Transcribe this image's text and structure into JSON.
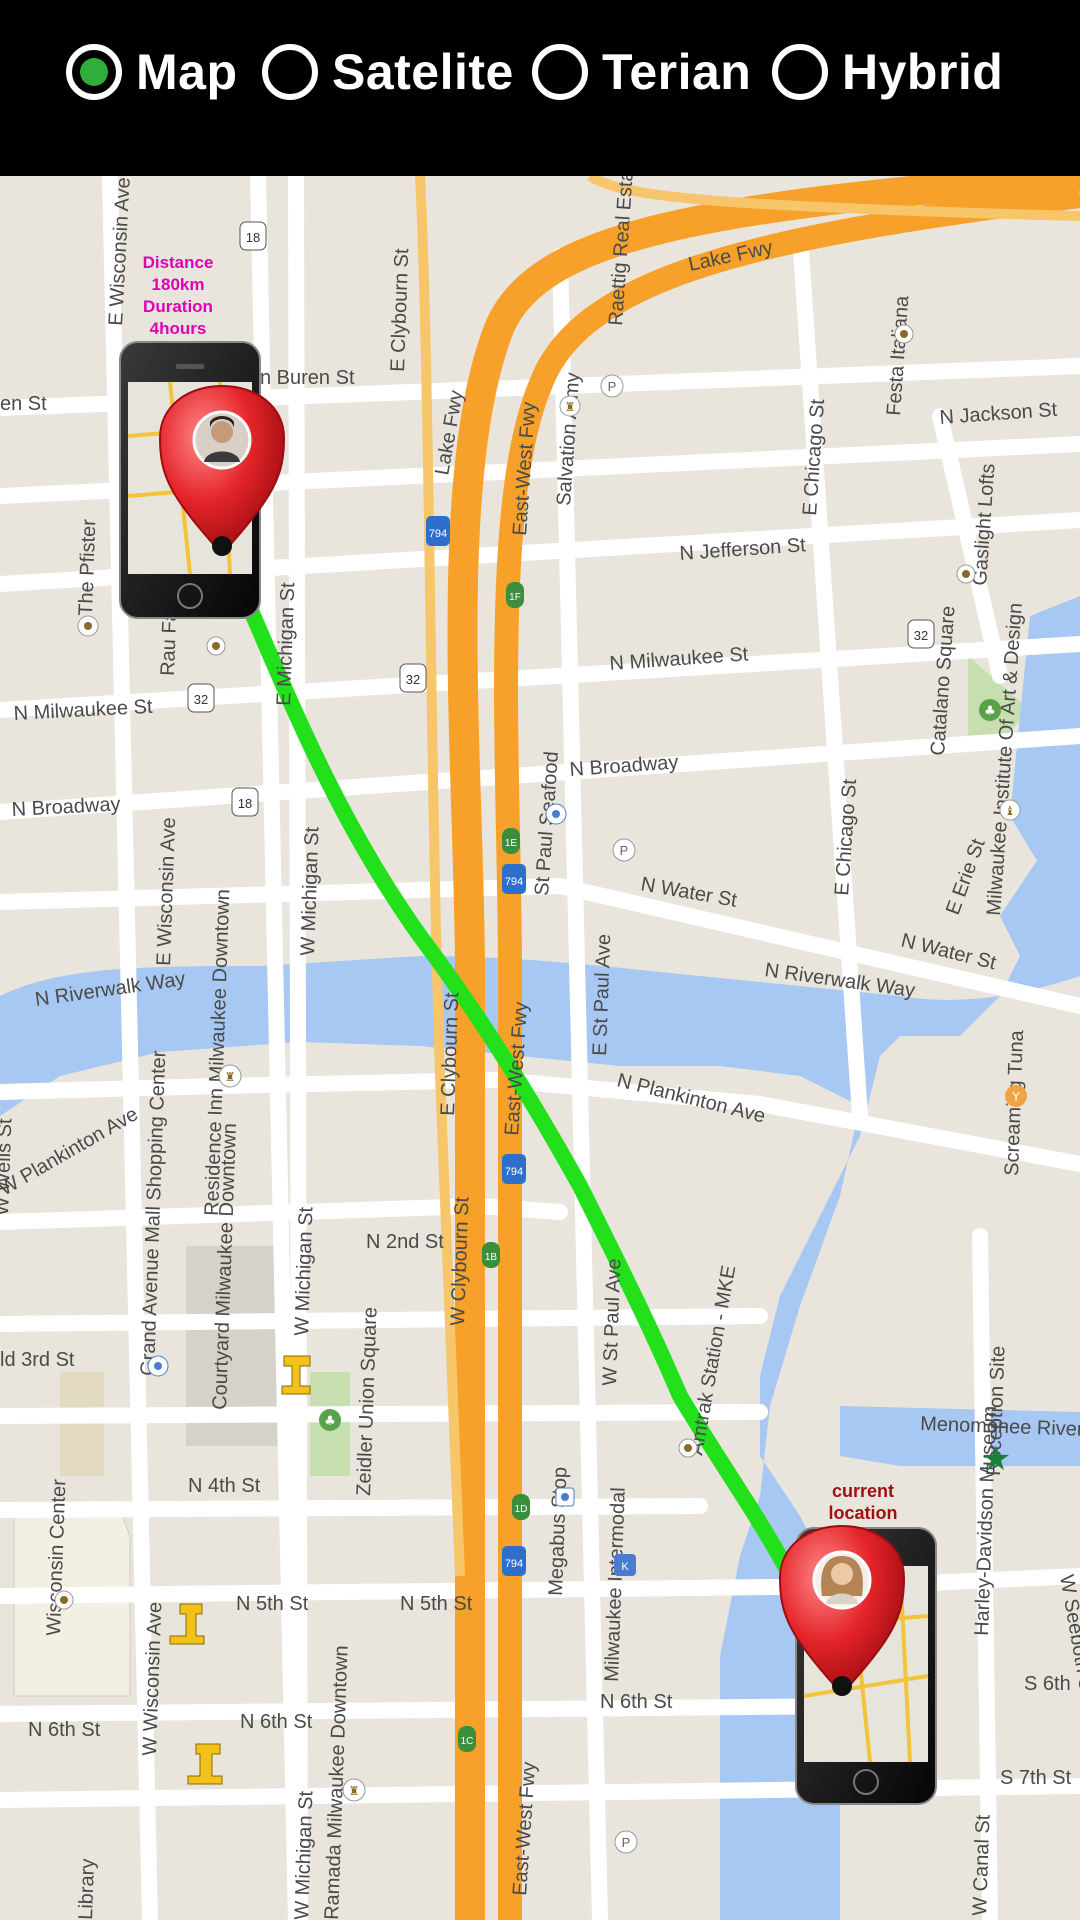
{
  "map_type_options": [
    {
      "label": "Map",
      "selected": true
    },
    {
      "label": "Satelite",
      "selected": false
    },
    {
      "label": "Terian",
      "selected": false
    },
    {
      "label": "Hybrid",
      "selected": false
    }
  ],
  "route": {
    "distance_label": "Distance",
    "distance_value": "180km",
    "duration_label": "Duration",
    "duration_value": "4hours",
    "current_location_line1": "current",
    "current_location_line2": "location",
    "route_color": "#22e01a"
  },
  "streets": {
    "lake_fwy": "Lake Fwy",
    "lake_fwy_top": "Lake Fwy",
    "east_west_fwy": "East-West Fwy",
    "n_jackson": "N Jackson St",
    "n_jefferson": "N Jefferson St",
    "n_milwaukee": "N Milwaukee St",
    "n_milwaukee_w": "N Milwaukee St",
    "n_broadway": "N Broadway",
    "n_broadway_w": "N Broadway",
    "n_water": "N Water St",
    "n_water_e": "N Water St",
    "riverwalk": "N Riverwalk Way",
    "riverwalk_e": "N Riverwalk Way",
    "plankinton": "W Plankinton Ave",
    "plankinton_e": "N Plankinton Ave",
    "n_2nd": "N 2nd St",
    "n_3rd": "ld 3rd St",
    "n_4th": "N 4th St",
    "n_5th": "N 5th St",
    "n_5th_w": "N 5th St",
    "n_6th": "N 6th St",
    "n_6th_w": "N 6th St",
    "n_6th_e": "N 6th St",
    "s_6th": "S 6th",
    "s_7th": "S 7th St",
    "van_buren": "n Buren St",
    "en_st": "en St",
    "e_wisconsin": "E Wisconsin Ave",
    "e_wisconsin_n": "E Wisconsin Ave",
    "w_wisconsin": "W Wisconsin Ave",
    "e_michigan": "E Michigan St",
    "w_michigan": "W Michigan St",
    "w_michigan_s": "W Michigan St",
    "e_clybourn": "E Clybourn St",
    "e_clybourn_n": "E Clybourn St",
    "w_clybourn": "W Clybourn St",
    "e_chicago": "E Chicago St",
    "e_chicago_s": "E Chicago St",
    "e_st_paul": "E St Paul Ave",
    "w_st_paul": "W St Paul Ave",
    "e_erie": "E Erie St",
    "menomonee": "Menomonee River",
    "w_canal": "W Canal St",
    "w_seeboth": "W Seeboth St",
    "n_wells": "W Wells St",
    "st_paul_seafood": "St Paul Seafood",
    "salvation_army": "Salvation Army",
    "festa_italiana": "Festa Italiana",
    "raettig": "Raettig Real Estate",
    "gaslight_lofts": "Gaslight Lofts",
    "catalano_square": "Catalano Square",
    "miad": "Milwaukee Institute Of Art & Design",
    "screaming_tuna": "Screaming Tuna",
    "reception_site": "Reception Site",
    "harley_museum": "Harley-Davidson Museum",
    "amtrak": "Amtrak Station - MKE",
    "megabus": "Megabus Stop",
    "intermodal": "Milwaukee Intermodal",
    "zeidler": "Zeidler Union Square",
    "courtyard": "Courtyard Milwaukee Downtown",
    "residence_inn": "Residence Inn Milwaukee Downtown",
    "grand_ave_mall": "Grand Avenue Mall Shopping Center",
    "wisconsin_center": "Wisconsin Center",
    "ramada": "Ramada Milwaukee Downtown",
    "the_pfister": "The Pfister",
    "rau_dentist": "Rau Family Dentist",
    "library": "Library"
  },
  "shields": {
    "i794": "794",
    "r18": "18",
    "r32": "32",
    "exit_1f": "1F",
    "exit_1e": "1E",
    "exit_1b": "1B",
    "exit_1c": "1C",
    "exit_1d": "1D"
  },
  "colors": {
    "map_bg": "#e9e5dc",
    "water": "#a7c8f2",
    "freeway": "#f7a12a",
    "road": "#ffffff",
    "park": "#c7dfb0",
    "pin": "#e5252a"
  }
}
